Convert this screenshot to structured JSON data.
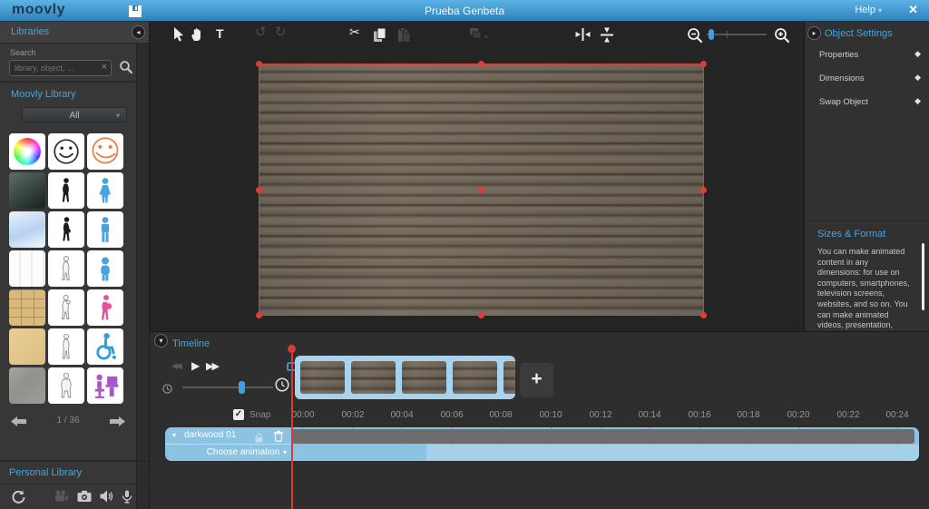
{
  "app": {
    "logo": "moovly",
    "title": "Prueba Genbeta",
    "help_label": "Help"
  },
  "icons": {
    "close": "✕",
    "clear": "×",
    "caret_down": "▾",
    "collapse_left": "◂",
    "collapse_right": "▸",
    "collapse_down": "▾",
    "diamond": "◆",
    "text_tool": "T",
    "undo": "↺",
    "redo": "↻",
    "scissors": "✂",
    "rewind": "◀◀",
    "play": "▶",
    "fast_forward": "▶▶",
    "check": "✓",
    "plus": "+",
    "library_items": [
      "color-wheel",
      "smiley-outline",
      "smiley-orange",
      "gradient-teal",
      "silhouette-woman",
      "figure-woman-blue",
      "gradient-lightblue",
      "silhouette-woman-2",
      "figure-man-blue",
      "texture-white",
      "sketch-figure",
      "figure-child-blue",
      "texture-brick",
      "sketch-mother",
      "figure-pregnant-pink",
      "texture-sand",
      "sketch-woman",
      "figure-wheelchair-blue",
      "texture-granite",
      "sketch-person",
      "figure-desk-purple"
    ]
  },
  "sidebar": {
    "header": "Libraries",
    "search_label": "Search",
    "search_placeholder": "library, object, ...",
    "moovly_library_heading": "Moovly Library",
    "filter_value": "All",
    "pagination": "1 / 36",
    "personal_library_heading": "Personal Library"
  },
  "object_settings": {
    "heading": "Object Settings",
    "items": [
      {
        "label": "Properties"
      },
      {
        "label": "Dimensions"
      },
      {
        "label": "Swap Object"
      }
    ]
  },
  "sizes_format": {
    "heading": "Sizes & Format",
    "body": "You can make animated content in any dimensions: for use on computers, smartphones, television screens, websites, and so on. You can make animated videos, presentation, banners, info graphs of any"
  },
  "timeline": {
    "heading": "Timeline",
    "snap_label": "Snap",
    "ruler": [
      "00:00",
      "00:02",
      "00:04",
      "00:06",
      "00:08",
      "00:10",
      "00:12",
      "00:14",
      "00:16",
      "00:18",
      "00:20",
      "00:22",
      "00:24"
    ],
    "track": {
      "name": "darkwood 01",
      "animation_label": "Choose animation"
    }
  },
  "colors": {
    "accent_blue": "#46a4da",
    "topbar_blue": "#2f83b9",
    "track_blue": "#8cc3e3",
    "playhead_red": "#d93a35",
    "selection_red": "#e23b36"
  }
}
